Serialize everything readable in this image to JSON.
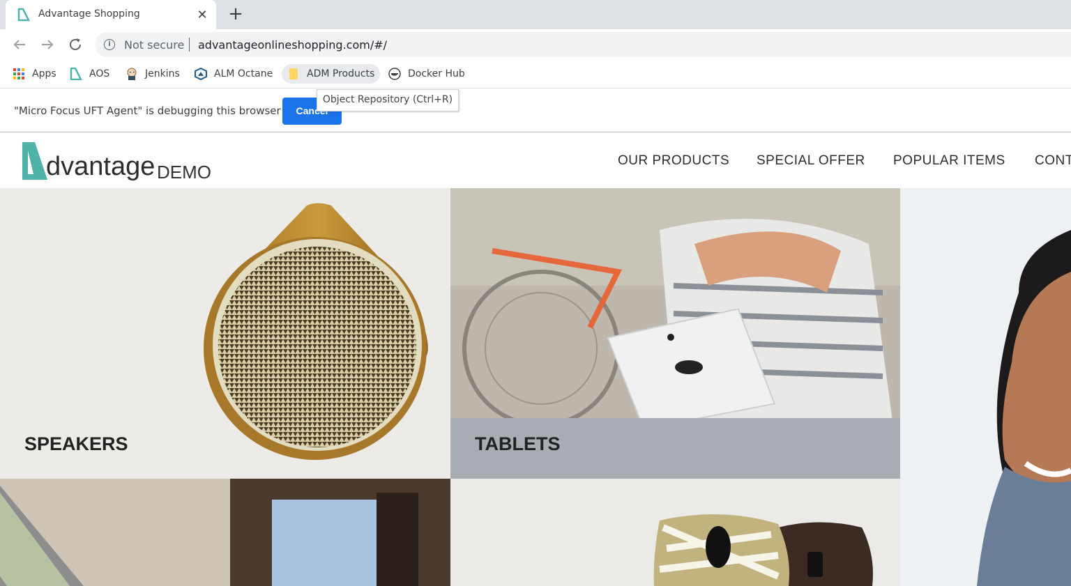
{
  "browser": {
    "tab": {
      "title": "Advantage Shopping",
      "close_glyph": "✕"
    },
    "new_tab_glyph": "+",
    "address": {
      "security": "Not secure",
      "url": "advantageonlineshopping.com/#/"
    },
    "bookmarks": [
      {
        "label": "Apps",
        "icon": "apps-grid-icon"
      },
      {
        "label": "AOS",
        "icon": "aos-logo-icon"
      },
      {
        "label": "Jenkins",
        "icon": "jenkins-icon"
      },
      {
        "label": "ALM Octane",
        "icon": "octane-icon"
      },
      {
        "label": "ADM Products",
        "icon": "folder-icon"
      },
      {
        "label": "Docker Hub",
        "icon": "docker-icon"
      }
    ],
    "tooltip": "Object Repository (Ctrl+R)",
    "infobar": {
      "message": "\"Micro Focus UFT Agent\" is debugging this browser",
      "cancel_label": "Cancel"
    }
  },
  "site": {
    "logo": {
      "word": "dvantage",
      "suffix": "DEMO"
    },
    "nav": [
      "OUR PRODUCTS",
      "SPECIAL OFFER",
      "POPULAR ITEMS",
      "CONT"
    ],
    "categories": [
      {
        "label": "SPEAKERS"
      },
      {
        "label": "TABLETS"
      }
    ]
  },
  "colors": {
    "brand_teal": "#4fb3a9",
    "chrome_blue": "#1a73e8"
  }
}
